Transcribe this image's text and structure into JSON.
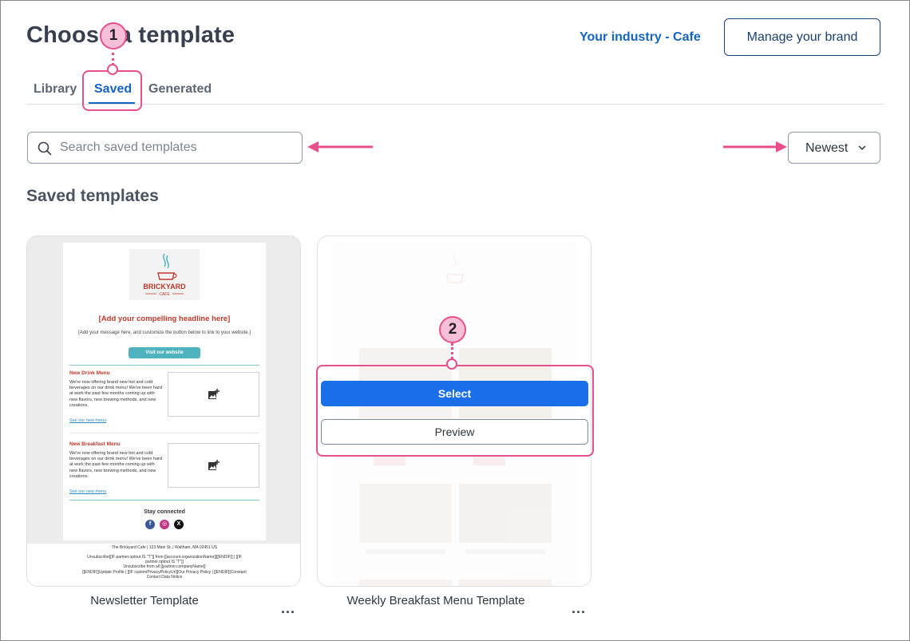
{
  "header": {
    "title": "Choose a template",
    "industry_link": "Your industry - Cafe",
    "manage_brand": "Manage your brand"
  },
  "tabs": [
    {
      "label": "Library"
    },
    {
      "label": "Saved",
      "active": true
    },
    {
      "label": "Generated"
    }
  ],
  "search": {
    "placeholder": "Search saved templates",
    "value": ""
  },
  "sort": {
    "selected": "Newest"
  },
  "section_title": "Saved templates",
  "callouts": [
    "1",
    "2"
  ],
  "accent_colors": {
    "link": "#1565c0",
    "primary_button": "#1a6ee8",
    "callout": "#e8508d"
  },
  "cards": [
    {
      "name": "Newsletter Template",
      "preview": {
        "brand": "BRICKYARD",
        "brand_sub": "CAFE",
        "headline": "[Add your compelling headline here]",
        "message": "[Add your message here, and customize the button below to link to your website.]",
        "button": "Visit our website",
        "sections": [
          {
            "title": "New Drink Menu",
            "body": "We're now offering brand new hot and cold beverages on our drink menu! We've been hard at work the past few months coming up with new flavors, new brewing methods, and new creations.",
            "link": "See our new menu"
          },
          {
            "title": "New Breakfast Menu",
            "body": "We're now offering brand new hot and cold beverages on our drink menu! We've been hard at work the past few months coming up with new flavors, new brewing methods, and new creations.",
            "link": "See our new menu"
          }
        ],
        "stay_connected": "Stay connected",
        "social": [
          "f",
          "◎",
          "X"
        ],
        "footer_address": "The Brickyard Cafe | 123 Main St. | Waltham, MA 02451 US",
        "footer_lines": [
          "Unsubscribe[[IF partner.optout IS \"T\"]] from [[account.organizationName]][[ENDIF]] | [[IF",
          "partner.optout IS \"T\"]]",
          "Unsubscribe from all [[partner.companyName]]",
          "[[ENDIF]]Update Profile | [[IF customPrivacyPolicyUrl]]Our Privacy Policy | [[ENDIF]]Constant",
          "Contact Data Notice"
        ]
      }
    },
    {
      "name": "Weekly Breakfast Menu Template",
      "actions": {
        "select": "Select",
        "preview": "Preview"
      }
    }
  ],
  "more_label": "..."
}
